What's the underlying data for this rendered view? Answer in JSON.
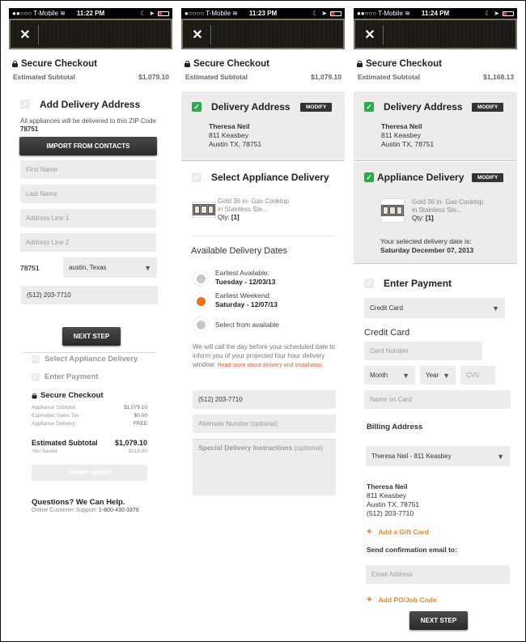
{
  "screens": [
    {
      "status": {
        "carrier": "●●○○○ T-Mobile ≋",
        "time": "11:22 PM"
      },
      "secure_checkout": "Secure Checkout",
      "subtotal_label": "Estimated Subtotal",
      "subtotal_value": "$1,079.10",
      "step_title": "Add Delivery Address",
      "zip_note": "All appliances will be delivered to this ZIP Code",
      "zip_code": "78751",
      "import_button": "IMPORT FROM CONTACTS",
      "first_name_placeholder": "First Name",
      "last_name_placeholder": "Last Name",
      "address1_placeholder": "Address Line 1",
      "address2_placeholder": "Address Line 2",
      "zip_label": "78751",
      "city_state_select": "austin, Texas",
      "phone_value": "(512) 203-7710",
      "next_step": "NEXT STEP",
      "step2_title": "Select Appliance Delivery",
      "step3_title": "Enter Payment",
      "summary": {
        "title": "Secure Checkout",
        "rows": [
          {
            "label": "Appliance Subtotal",
            "value": "$1,079.10"
          },
          {
            "label": "Estimated Sales Tax",
            "value": "$0.00"
          },
          {
            "label": "Appliance Delivery",
            "value": "FREE"
          }
        ],
        "estimated_label": "Estimated Subtotal",
        "estimated_value": "$1,079.10",
        "saved_label": "You Saved",
        "saved_value": "$119.90",
        "submit": "SUBMIT ORDER"
      },
      "help_title": "Questions? We Can Help.",
      "help_support_label": "Online Customer Support:",
      "help_phone": "1-800-430-3376"
    },
    {
      "status": {
        "carrier": "●○○○○ T-Mobile ≋",
        "time": "11:23 PM"
      },
      "secure_checkout": "Secure Checkout",
      "subtotal_label": "Estimated Subtotal",
      "subtotal_value": "$1,079.10",
      "delivery_address_title": "Delivery Address",
      "modify": "MODIFY",
      "address": {
        "name": "Theresa Neil",
        "street": "811 Keasbey",
        "city": "Austin TX, 78751"
      },
      "step_title": "Select Appliance Delivery",
      "product": {
        "name_line1": "Gold 36 in- Gas Cooktop",
        "name_line2": "in Stainless Ste...",
        "qty_label": "Qty:",
        "qty_value": "[1]"
      },
      "dates_title": "Available Delivery Dates",
      "date_options": [
        {
          "line1": "Earliest Available:",
          "line2": "Tuesday - 12/03/13",
          "selected": false
        },
        {
          "line1": "Earliest Weekend:",
          "line2": "Saturday - 12/07/13",
          "selected": true
        },
        {
          "line1": "Select from available",
          "line2": "",
          "selected": false
        }
      ],
      "call_note": "We will call the day before your scheduled date to inform you of your projected four hour delivery window.",
      "read_more": "Read more about delivery and installation.",
      "phone_value": "(512) 203-7710",
      "alt_phone_placeholder": "Alternate Number (optional)",
      "instructions_label": "Special Delivery Instructions",
      "instructions_optional": "(optional)"
    },
    {
      "status": {
        "carrier": "●●○○○ T-Mobile ≋",
        "time": "11:24 PM"
      },
      "secure_checkout": "Secure Checkout",
      "subtotal_label": "Estimated Subtotal",
      "subtotal_value": "$1,168.13",
      "delivery_address_title": "Delivery Address",
      "modify": "MODIFY",
      "address": {
        "name": "Theresa Neil",
        "street": "811 Keasbey",
        "city": "Austin TX, 78751"
      },
      "appliance_delivery_title": "Appliance Delivery",
      "product": {
        "name_line1": "Gold 36 in- Gas Cooktop",
        "name_line2": "in Stainless Ste...",
        "qty_label": "Qty:",
        "qty_value": "[1]"
      },
      "selected_date_label": "Your selected delivery date is:",
      "selected_date_value": "Saturday December 07, 2013",
      "payment_title": "Enter Payment",
      "payment_method": "Credit Card",
      "credit_card_heading": "Credit Card",
      "card_number_placeholder": "Card Number",
      "month_select": "Month",
      "year_select": "Year",
      "cvv_placeholder": "CVV",
      "name_on_card_placeholder": "Name on Card",
      "billing_title": "Billing Address",
      "billing_select": "Theresa Neil - 811 Keasbey",
      "billing_address": {
        "name": "Theresa Neil",
        "street": "811 Keasbey",
        "city": "Austin TX, 78751",
        "phone": "(512) 203-7710"
      },
      "gift_card": "Add a Gift Card",
      "email_label": "Send confirmation email to:",
      "email_placeholder": "Email Address",
      "po_code": "Add PO/Job Code",
      "next_step": "NEXT STEP"
    }
  ]
}
